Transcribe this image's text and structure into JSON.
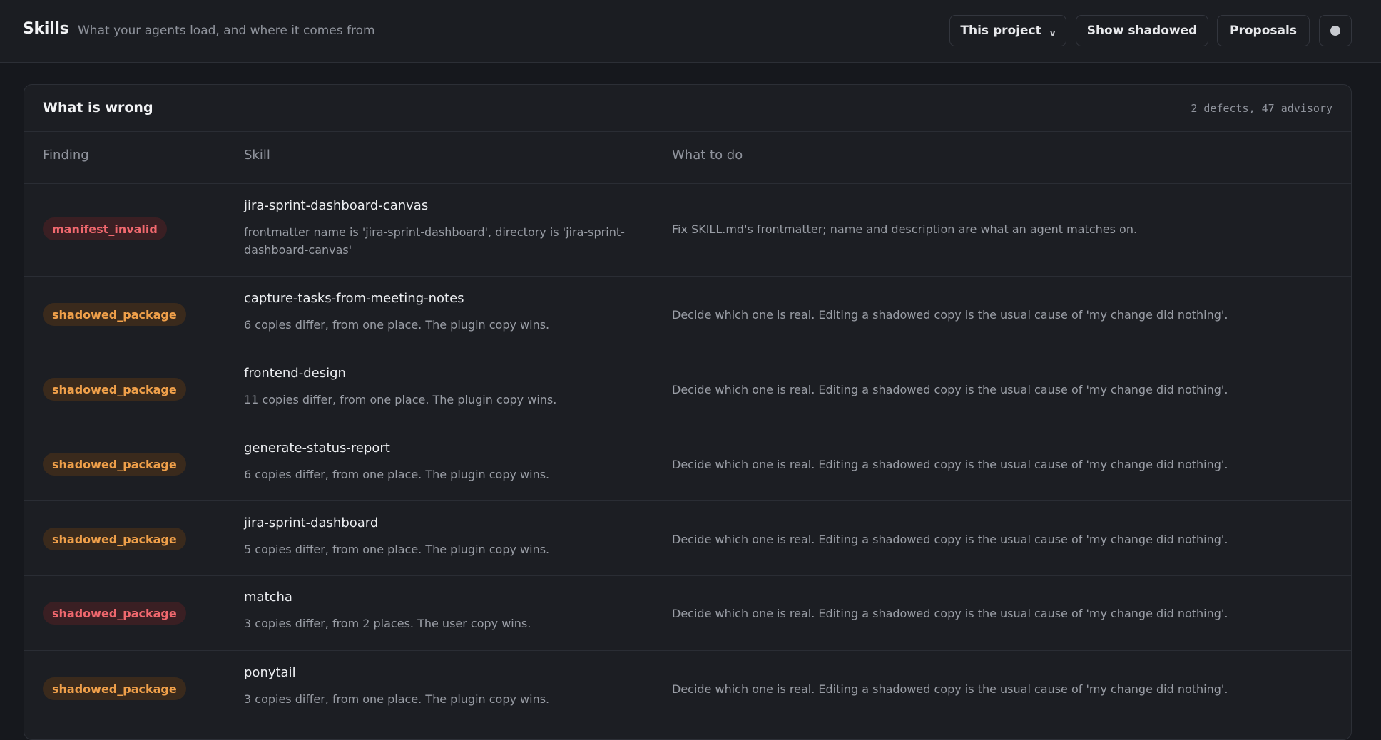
{
  "header": {
    "title": "Skills",
    "subtitle": "What your agents load, and where it comes from",
    "scope_label": "This project",
    "show_shadowed_label": "Show shadowed",
    "proposals_label": "Proposals",
    "status_icon": "status-dot-icon"
  },
  "panel": {
    "title": "What is wrong",
    "summary": "2 defects, 47 advisory",
    "columns": {
      "finding": "Finding",
      "skill": "Skill",
      "todo": "What to do"
    }
  },
  "colors": {
    "defect_badge_bg": "#3a1f23",
    "defect_badge_text": "#f0686e",
    "advisory_badge_bg": "#3a2a1c",
    "advisory_badge_text": "#f0a04a"
  },
  "rows": [
    {
      "finding": "manifest_invalid",
      "severity": "defect",
      "skill": "jira-sprint-dashboard-canvas",
      "detail": "frontmatter name is 'jira-sprint-dashboard', directory is 'jira-sprint-dashboard-canvas'",
      "todo": "Fix SKILL.md's frontmatter; name and description are what an agent matches on."
    },
    {
      "finding": "shadowed_package",
      "severity": "advisory",
      "skill": "capture-tasks-from-meeting-notes",
      "detail": "6 copies differ, from one place. The plugin copy wins.",
      "todo": "Decide which one is real. Editing a shadowed copy is the usual cause of 'my change did nothing'."
    },
    {
      "finding": "shadowed_package",
      "severity": "advisory",
      "skill": "frontend-design",
      "detail": "11 copies differ, from one place. The plugin copy wins.",
      "todo": "Decide which one is real. Editing a shadowed copy is the usual cause of 'my change did nothing'."
    },
    {
      "finding": "shadowed_package",
      "severity": "advisory",
      "skill": "generate-status-report",
      "detail": "6 copies differ, from one place. The plugin copy wins.",
      "todo": "Decide which one is real. Editing a shadowed copy is the usual cause of 'my change did nothing'."
    },
    {
      "finding": "shadowed_package",
      "severity": "advisory",
      "skill": "jira-sprint-dashboard",
      "detail": "5 copies differ, from one place. The plugin copy wins.",
      "todo": "Decide which one is real. Editing a shadowed copy is the usual cause of 'my change did nothing'."
    },
    {
      "finding": "shadowed_package",
      "severity": "defect",
      "skill": "matcha",
      "detail": "3 copies differ, from 2 places. The user copy wins.",
      "todo": "Decide which one is real. Editing a shadowed copy is the usual cause of 'my change did nothing'."
    },
    {
      "finding": "shadowed_package",
      "severity": "advisory",
      "skill": "ponytail",
      "detail": "3 copies differ, from one place. The plugin copy wins.",
      "todo": "Decide which one is real. Editing a shadowed copy is the usual cause of 'my change did nothing'."
    }
  ]
}
